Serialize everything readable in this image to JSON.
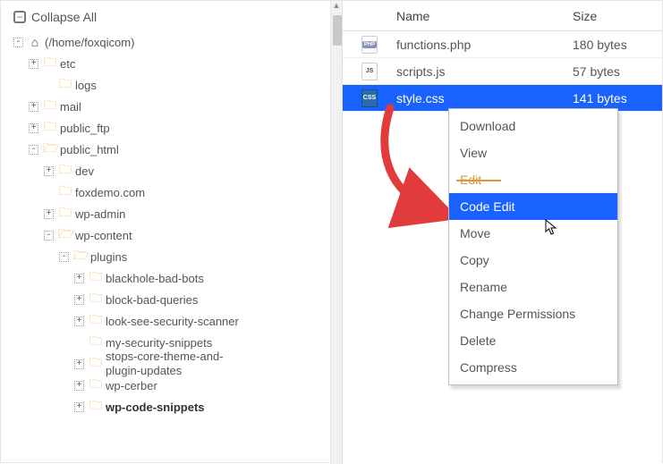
{
  "collapse_label": "Collapse All",
  "root": "(/home/foxqicom)",
  "tree": {
    "etc": "etc",
    "logs": "logs",
    "mail": "mail",
    "public_ftp": "public_ftp",
    "public_html": "public_html",
    "dev": "dev",
    "foxdemo": "foxdemo.com",
    "wpadmin": "wp-admin",
    "wpcontent": "wp-content",
    "plugins": "plugins",
    "p1": "blackhole-bad-bots",
    "p2": "block-bad-queries",
    "p3": "look-see-security-scanner",
    "p4": "my-security-snippets",
    "p5": "stops-core-theme-and-plugin-updates",
    "p6": "wp-cerber",
    "p7": "wp-code-snippets"
  },
  "cols": {
    "name": "Name",
    "size": "Size"
  },
  "files": [
    {
      "name": "functions.php",
      "size": "180 bytes"
    },
    {
      "name": "scripts.js",
      "size": "57 bytes"
    },
    {
      "name": "style.css",
      "size": "141 bytes"
    }
  ],
  "menu": {
    "download": "Download",
    "view": "View",
    "edit": "Edit",
    "codeedit": "Code Edit",
    "move": "Move",
    "copy": "Copy",
    "rename": "Rename",
    "perms": "Change Permissions",
    "delete": "Delete",
    "compress": "Compress"
  }
}
